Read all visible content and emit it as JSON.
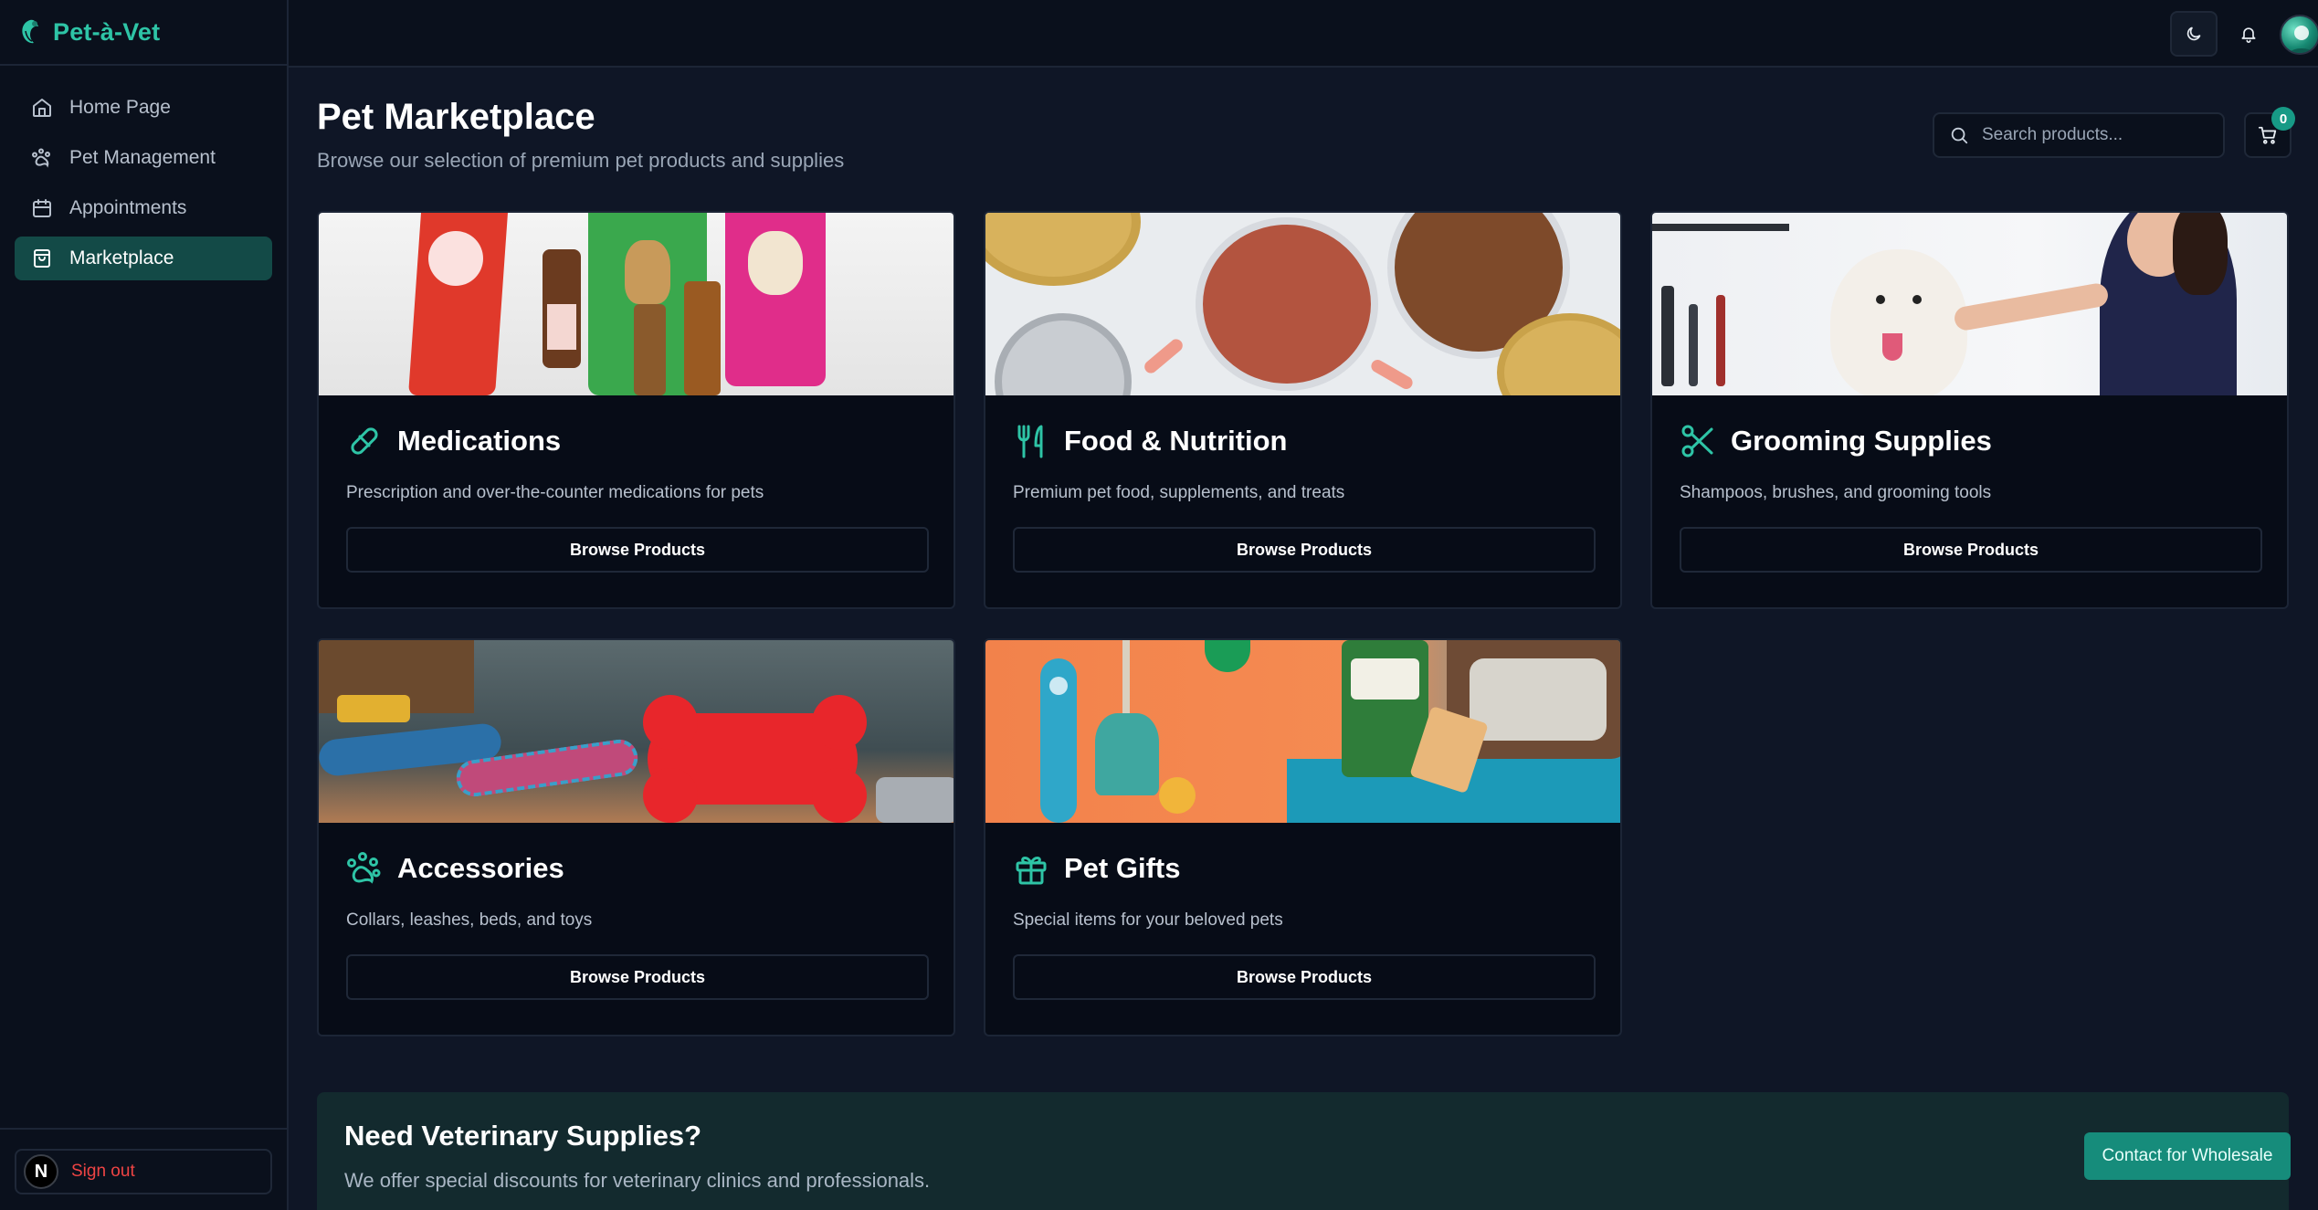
{
  "brand": {
    "name": "Pet-à-Vet"
  },
  "sidebar": {
    "items": [
      {
        "label": "Home Page",
        "icon": "home-icon",
        "active": false
      },
      {
        "label": "Pet Management",
        "icon": "paw-icon",
        "active": false
      },
      {
        "label": "Appointments",
        "icon": "calendar-icon",
        "active": false
      },
      {
        "label": "Marketplace",
        "icon": "shopping-bag-icon",
        "active": true
      }
    ],
    "signout_label": "Sign out",
    "signout_avatar": "N"
  },
  "header": {
    "title": "Pet Marketplace",
    "subtitle": "Browse our selection of premium pet products and supplies",
    "search_placeholder": "Search products...",
    "cart_count": "0"
  },
  "categories": [
    {
      "title": "Medications",
      "icon": "pill-icon",
      "description": "Prescription and over-the-counter medications for pets",
      "button": "Browse Products"
    },
    {
      "title": "Food & Nutrition",
      "icon": "utensils-icon",
      "description": "Premium pet food, supplements, and treats",
      "button": "Browse Products"
    },
    {
      "title": "Grooming Supplies",
      "icon": "scissors-icon",
      "description": "Shampoos, brushes, and grooming tools",
      "button": "Browse Products"
    },
    {
      "title": "Accessories",
      "icon": "paw-icon",
      "description": "Collars, leashes, beds, and toys",
      "button": "Browse Products"
    },
    {
      "title": "Pet Gifts",
      "icon": "gift-icon",
      "description": "Special items for your beloved pets",
      "button": "Browse Products"
    }
  ],
  "banner": {
    "title": "Need Veterinary Supplies?",
    "description": "We offer special discounts for veterinary clinics and professionals.",
    "button": "Contact for Wholesale"
  },
  "colors": {
    "accent": "#2ec4a6",
    "active_nav": "#134a47",
    "signout": "#ef4444",
    "wholesale_button": "#168c7b",
    "background": "#0f1626"
  }
}
